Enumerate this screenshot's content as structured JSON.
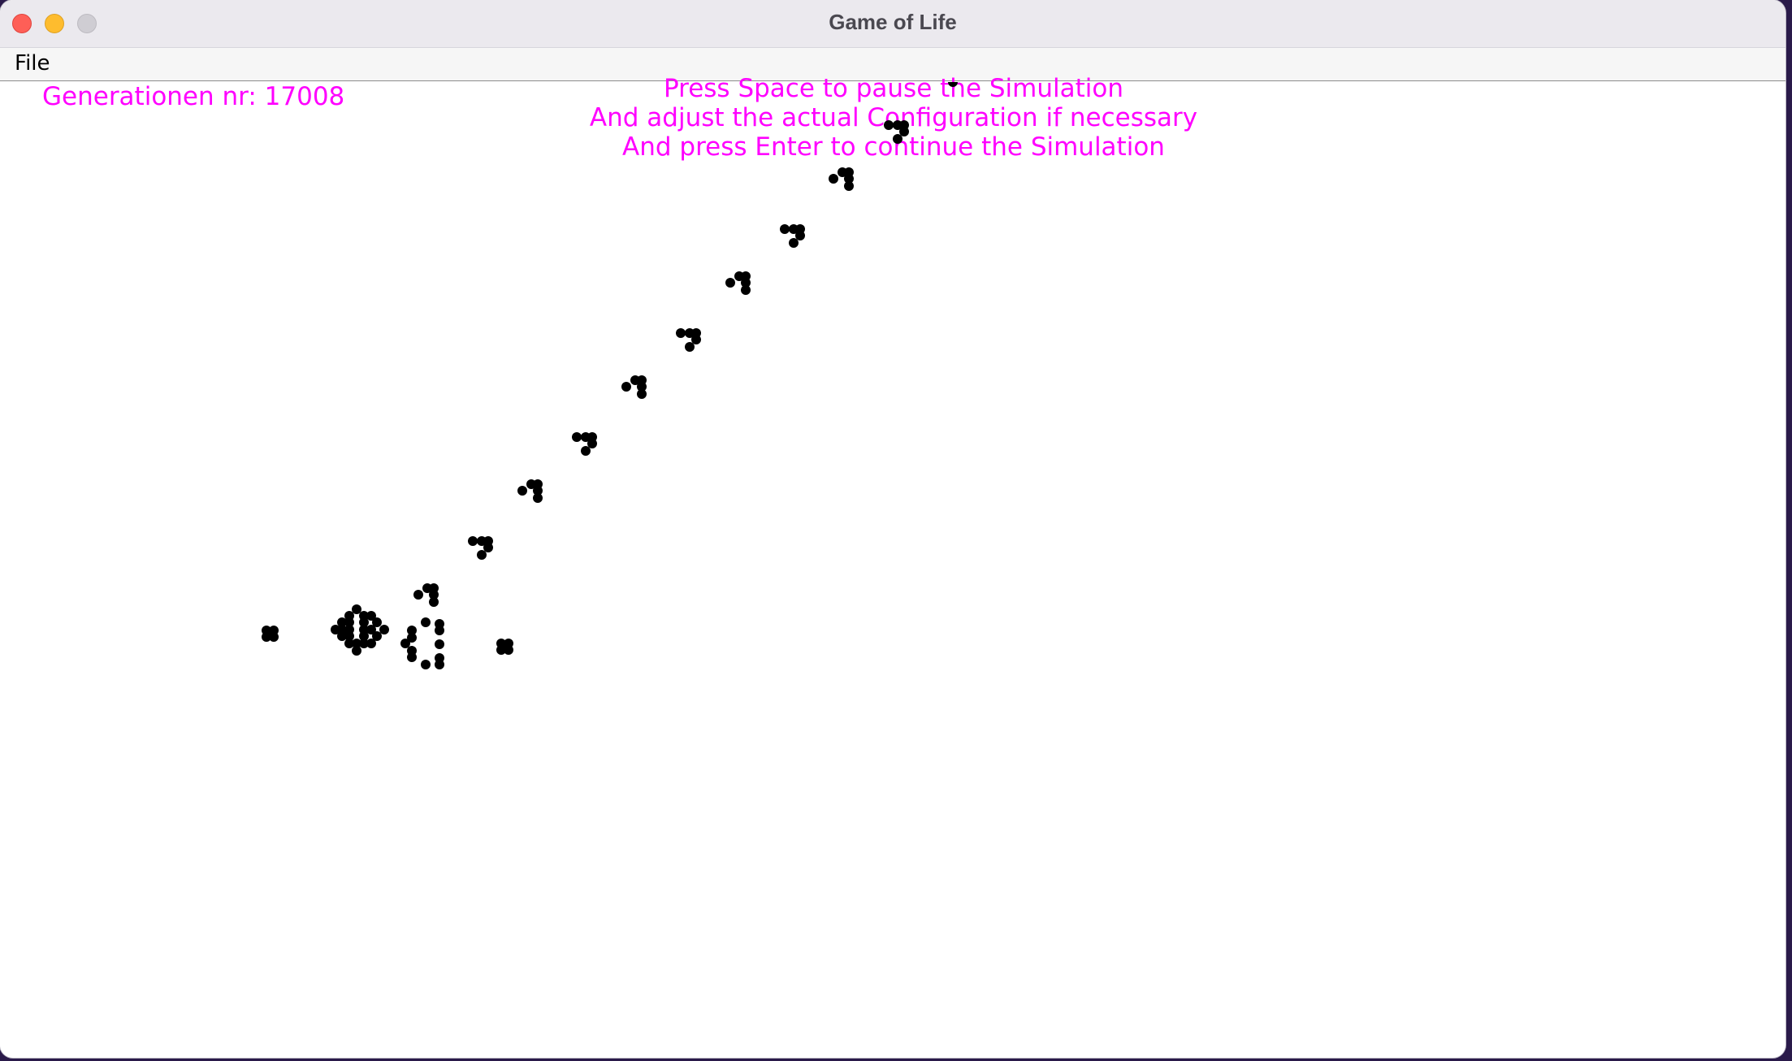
{
  "window": {
    "title": "Game of Life"
  },
  "menu": {
    "items": [
      "File"
    ]
  },
  "status": {
    "generation_text": "Generationen nr: 17008"
  },
  "instructions": {
    "lines": [
      "Press Space to pause the Simulation",
      "And adjust the actual Configuration if necessary",
      "And press Enter to continue the Simulation"
    ]
  },
  "colors": {
    "text_accent": "#ff00ff",
    "cell": "#000000",
    "background": "#ffffff"
  }
}
